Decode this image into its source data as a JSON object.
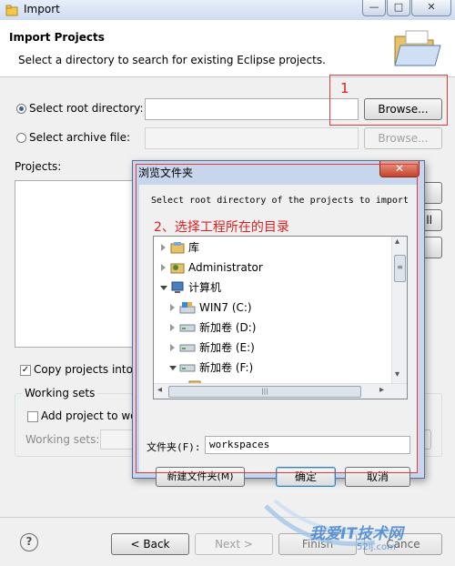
{
  "window": {
    "title": "Import",
    "minimize_glyph": "—",
    "maximize_glyph": "□",
    "close_glyph": "✕"
  },
  "header": {
    "title": "Import Projects",
    "subtitle": "Select a directory to search for existing Eclipse projects."
  },
  "form": {
    "root_label": "Select root directory:",
    "root_value": "",
    "browse_label": "Browse...",
    "archive_label": "Select archive file:",
    "archive_value": "",
    "browse2_label": "Browse...",
    "projects_label": "Projects:",
    "side_btn_1": "",
    "side_btn_2": "ll",
    "side_btn_3": "",
    "copy_label": "Copy projects into w",
    "working_sets_group": "Working sets",
    "add_label": "Add project to wo",
    "working_sets_label": "Working sets:"
  },
  "annotations": {
    "step1": "1",
    "step2": "2、选择工程所在的目录"
  },
  "dialog": {
    "title": "浏览文件夹",
    "close_glyph": "✕",
    "prompt": "Select root directory of the projects to import",
    "tree": [
      {
        "label": "库",
        "icon": "library-icon"
      },
      {
        "label": "Administrator",
        "icon": "user-folder-icon"
      },
      {
        "label": "计算机",
        "icon": "computer-icon"
      },
      {
        "label": "WIN7 (C:)",
        "icon": "system-drive-icon"
      },
      {
        "label": "新加卷 (D:)",
        "icon": "drive-icon"
      },
      {
        "label": "新加卷 (E:)",
        "icon": "drive-icon"
      },
      {
        "label": "新加卷 (F:)",
        "icon": "drive-icon"
      },
      {
        "label": "",
        "icon": "folder-icon"
      }
    ],
    "folder_label": "文件夹(F):",
    "folder_value": "workspaces",
    "new_folder_button": "新建文件夹(M)",
    "ok_button": "确定",
    "cancel_button": "取消",
    "scroll_left": "◂",
    "scroll_right": "▸",
    "scroll_up": "▴",
    "scroll_down": "▾",
    "scroll_grip": "≡",
    "scroll_hgrip": "|||"
  },
  "footer": {
    "help_glyph": "?",
    "back_button": "< Back",
    "next_button": "Next >",
    "finish_button": "Finish",
    "cancel_button": "Cance"
  },
  "watermark": {
    "text": "我爱IT技术网",
    "url": "52ij.com"
  },
  "colors": {
    "annotation_red": "#e02020",
    "dialog_frame": "#c7d6ec",
    "accent_blue": "#3b5fa8"
  }
}
